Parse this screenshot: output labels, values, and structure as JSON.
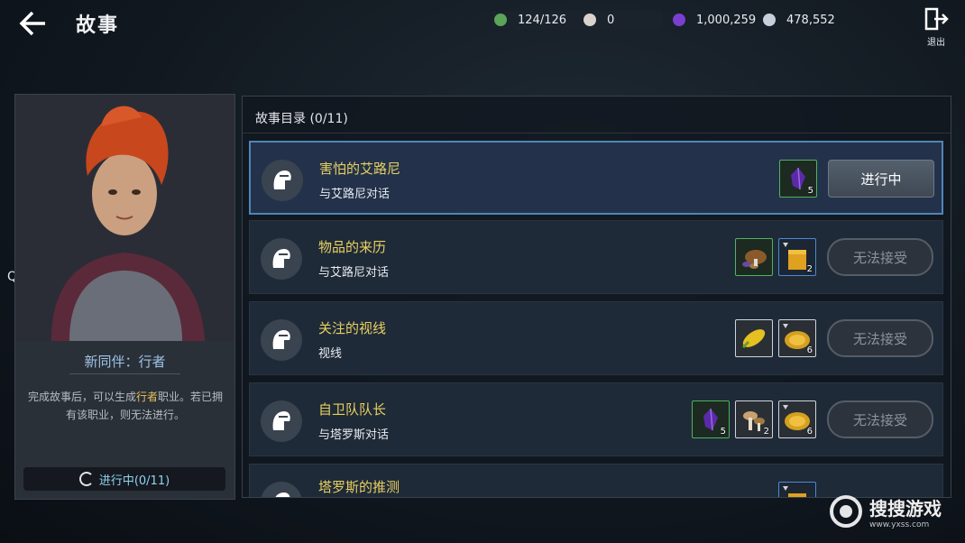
{
  "header": {
    "title": "故事"
  },
  "resources": [
    {
      "name": "stamina",
      "value": "124/126",
      "color": "#5aa55a",
      "icon": "leaf-coin-icon"
    },
    {
      "name": "pearl",
      "value": "0",
      "color": "#d9d3cc",
      "icon": "pearl-icon"
    },
    {
      "name": "black-stone",
      "value": "1,000,259",
      "color": "#7a3fd1",
      "icon": "purple-gem-icon"
    },
    {
      "name": "silver",
      "value": "478,552",
      "color": "#c7d0da",
      "icon": "silver-coin-icon"
    }
  ],
  "exit": {
    "label": "退出"
  },
  "side_label": "QA",
  "companion": {
    "name": "新同伴：行者",
    "desc_prefix": "完成故事后，可以生成",
    "desc_highlight": "行者",
    "desc_suffix": "职业。若已拥有该职业，则无法进行。",
    "progress": "进行中(0/11)"
  },
  "panel": {
    "header": "故事目录 (0/11)"
  },
  "stories": [
    {
      "title": "害怕的艾路尼",
      "sub": "与艾路尼对话",
      "button": "进行中",
      "rewards": [
        {
          "type": "purple-gem",
          "border": "green",
          "qty": "5"
        }
      ]
    },
    {
      "title": "物品的来历",
      "sub": "与艾路尼对话",
      "button": "无法接受",
      "rewards": [
        {
          "type": "mushroom-pile",
          "border": "green",
          "qty": ""
        },
        {
          "type": "yellow-box",
          "border": "blue",
          "qty": "2"
        }
      ]
    },
    {
      "title": "关注的视线",
      "sub": "视线",
      "button": "无法接受",
      "rewards": [
        {
          "type": "corn",
          "border": "white",
          "qty": ""
        },
        {
          "type": "gold-plate",
          "border": "white",
          "qty": "6"
        }
      ]
    },
    {
      "title": "自卫队队长",
      "sub": "与塔罗斯对话",
      "button": "无法接受",
      "rewards": [
        {
          "type": "purple-gem",
          "border": "green",
          "qty": "5"
        },
        {
          "type": "mushroom",
          "border": "white",
          "qty": "2"
        },
        {
          "type": "gold-plate",
          "border": "white",
          "qty": "6"
        }
      ]
    },
    {
      "title": "塔罗斯的推测",
      "sub": "",
      "button": "",
      "rewards": [
        {
          "type": "yellow-box",
          "border": "blue",
          "qty": ""
        }
      ]
    }
  ],
  "watermark": {
    "text": "搜搜游戏",
    "sub": "www.yxss.com"
  }
}
